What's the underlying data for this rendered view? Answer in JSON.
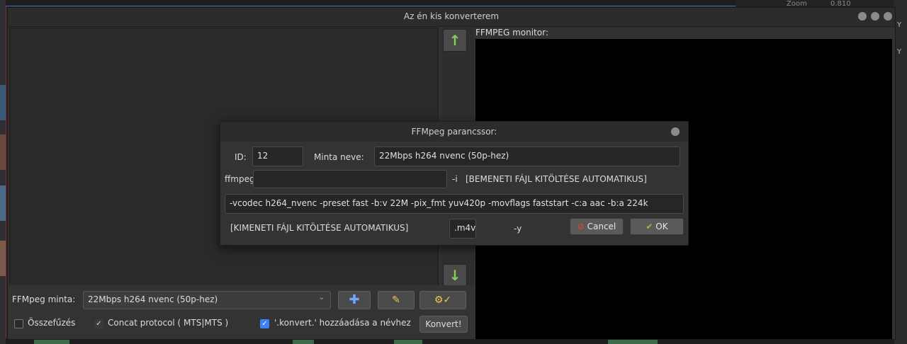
{
  "background": {
    "zoom_label": "Zoom",
    "zoom_value": "0.810",
    "right_letters": [
      "Y",
      "Y"
    ]
  },
  "window": {
    "title": "Az én kis konverterem",
    "monitor_label": "FFMPEG monitor:",
    "up_icon": "arrow-up-icon",
    "down_icon": "arrow-down-icon"
  },
  "bottom": {
    "preset_label": "FFMpeg minta:",
    "preset_value": "22Mbps h264 nvenc (50p-hez)",
    "merge_label": "Összefűzés",
    "concat_label": "Concat protocol ( MTS|MTS )",
    "append_label": "'.konvert.' hozzáadása a névhez",
    "convert_button": "Konvert!",
    "merge_checked": false,
    "concat_checked": true,
    "append_checked": true
  },
  "dialog": {
    "title": "FFMpeg parancssor:",
    "id_label": "ID:",
    "id_value": "12",
    "name_label": "Minta neve:",
    "name_value": "22Mbps h264 nvenc (50p-hez)",
    "ffmpeg_label": "ffmpeg",
    "pre_input_value": "",
    "input_flag": "-i",
    "input_placeholder": "[BEMENETI FÁJL KITÖLTÉSE AUTOMATIKUS]",
    "args_value": "-vcodec h264_nvenc -preset fast -b:v 22M -pix_fmt yuv420p -movflags faststart -c:a aac -b:a 224k",
    "output_placeholder": "[KIMENETI FÁJL KITÖLTÉSE AUTOMATIKUS]",
    "extension_value": ".m4v",
    "overwrite_flag": "-y",
    "cancel_label": "Cancel",
    "ok_label": "OK"
  },
  "colors": {
    "arrow_green": "#7fd35b",
    "cancel_red": "#e0453a",
    "ok_green": "#8bc34a",
    "checkbox_blue": "#3b82f6"
  }
}
